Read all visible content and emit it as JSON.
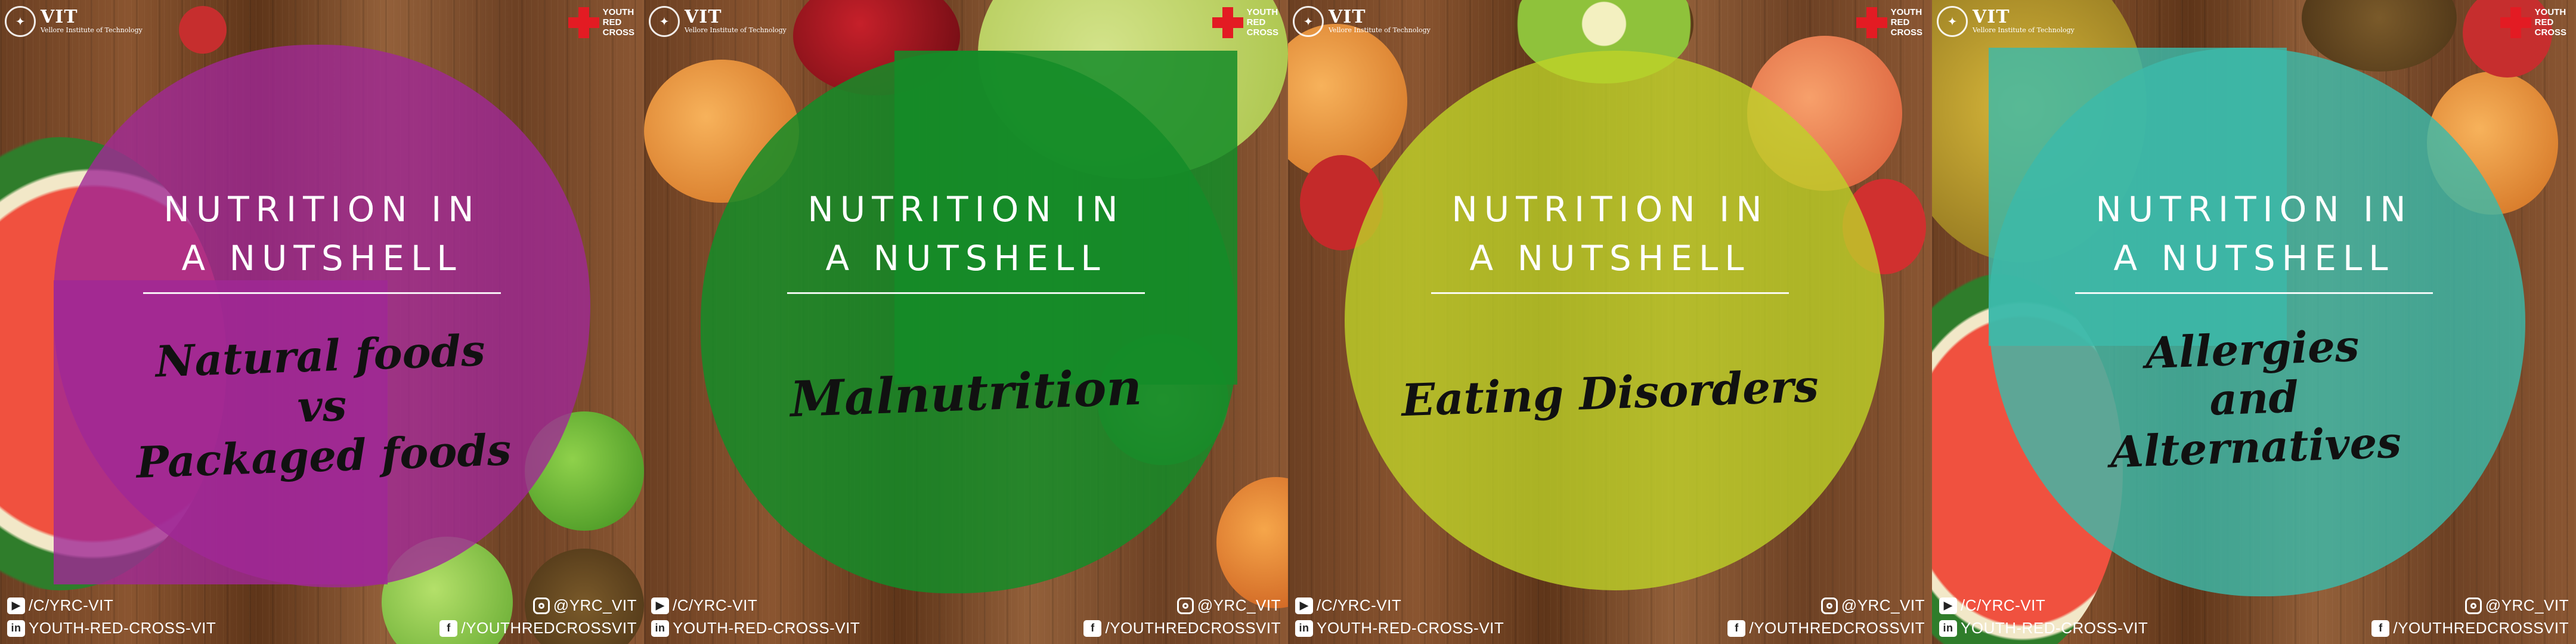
{
  "panels": [
    {
      "title_line1": "NUTRITION IN",
      "title_line2": "A NUTSHELL",
      "subtitle_lines": [
        "Natural foods",
        "vs",
        "Packaged foods"
      ],
      "overlay_color": "#a0289690"
    },
    {
      "title_line1": "NUTRITION IN",
      "title_line2": "A NUTSHELL",
      "subtitle_lines": [
        "Malnutrition"
      ],
      "overlay_color": "#148c28"
    },
    {
      "title_line1": "NUTRITION IN",
      "title_line2": "A NUTSHELL",
      "subtitle_lines": [
        "Eating Disorders"
      ],
      "overlay_color": "#bed228"
    },
    {
      "title_line1": "NUTRITION IN",
      "title_line2": "A NUTSHELL",
      "subtitle_lines": [
        "Allergies",
        "and",
        "Alternatives"
      ],
      "overlay_color": "#3cb9aa"
    }
  ],
  "branding": {
    "vit_logo": "VIT",
    "vit_subtitle": "Vellore Institute of Technology",
    "yrc_line1": "YOUTH",
    "yrc_line2": "RED",
    "yrc_line3": "CROSS",
    "cross_color": "#e31b23"
  },
  "social": {
    "youtube": "/C/YRC-VIT",
    "linkedin": "YOUTH-RED-CROSS-VIT",
    "instagram": "@YRC_VIT",
    "facebook": "/YOUTHREDCROSSVIT",
    "youtube_icon": "youtube-icon",
    "linkedin_icon": "linkedin-icon",
    "instagram_icon": "instagram-icon",
    "facebook_icon": "facebook-icon"
  }
}
